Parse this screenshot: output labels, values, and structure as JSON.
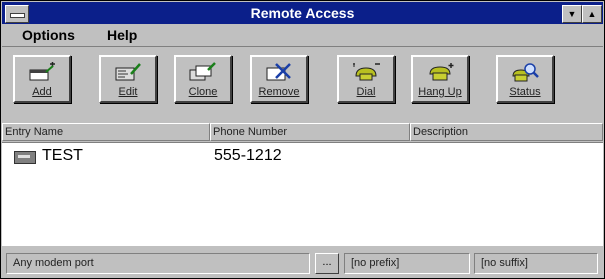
{
  "window": {
    "title": "Remote Access"
  },
  "menubar": {
    "items": [
      {
        "label": "Options",
        "mnemonic": "O"
      },
      {
        "label": "Help",
        "mnemonic": "H"
      }
    ]
  },
  "toolbar": {
    "buttons": [
      {
        "label": "Add",
        "icon": "add-entry-icon"
      },
      {
        "label": "Edit",
        "icon": "edit-entry-icon"
      },
      {
        "label": "Clone",
        "icon": "clone-entry-icon"
      },
      {
        "label": "Remove",
        "icon": "remove-entry-icon"
      },
      {
        "label": "Dial",
        "icon": "dial-phone-icon"
      },
      {
        "label": "Hang Up",
        "icon": "hang-up-phone-icon"
      },
      {
        "label": "Status",
        "icon": "status-magnifier-icon"
      }
    ]
  },
  "list": {
    "columns": [
      "Entry Name",
      "Phone Number",
      "Description"
    ],
    "rows": [
      {
        "entry_name": "TEST",
        "phone_number": "555-1212",
        "description": ""
      }
    ]
  },
  "statusbar": {
    "port": "Any modem port",
    "browse_button": "...",
    "prefix": "[no prefix]",
    "suffix": "[no suffix]"
  },
  "colors": {
    "titlebar": "#0b1f8a",
    "face": "#c0c0c0",
    "list_bg": "#ffffff"
  }
}
